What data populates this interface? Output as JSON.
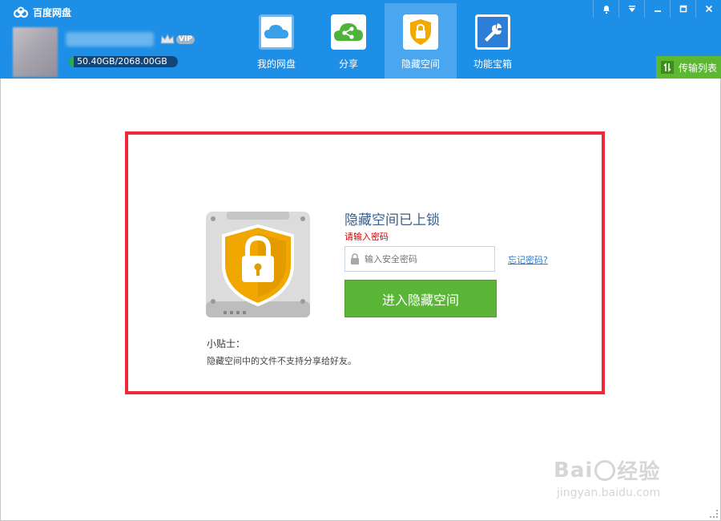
{
  "app": {
    "title": "百度网盘",
    "storage": "50.40GB/2068.00GB",
    "storage_used_fraction": 0.024,
    "vip_label": "VIP"
  },
  "nav": {
    "items": [
      {
        "label": "我的网盘",
        "icon": "cloud-icon"
      },
      {
        "label": "分享",
        "icon": "share-icon"
      },
      {
        "label": "隐藏空间",
        "icon": "shield-lock-icon",
        "active": true
      },
      {
        "label": "功能宝箱",
        "icon": "wrench-icon"
      }
    ]
  },
  "window_controls": [
    "bell-icon",
    "menu-icon",
    "minimize-icon",
    "maximize-icon",
    "close-icon"
  ],
  "transfer": {
    "label": "传输列表"
  },
  "hidden_space": {
    "title": "隐藏空间已上锁",
    "hint": "请输入密码",
    "password_placeholder": "输入安全密码",
    "forgot_link": "忘记密码?",
    "enter_button": "进入隐藏空间",
    "tips_title": "小贴士：",
    "tips_body": "隐藏空间中的文件不支持分享给好友。"
  },
  "watermark": {
    "main": "Bai",
    "brand": "经验",
    "sub": "jingyan.baidu.com"
  },
  "colors": {
    "titlebar": "#1e8fe6",
    "active_tab": "#4aa7ef",
    "primary_button": "#5bb637",
    "highlight_border": "#ef2a38",
    "error_text": "#d40000",
    "link": "#2e7bcf"
  }
}
